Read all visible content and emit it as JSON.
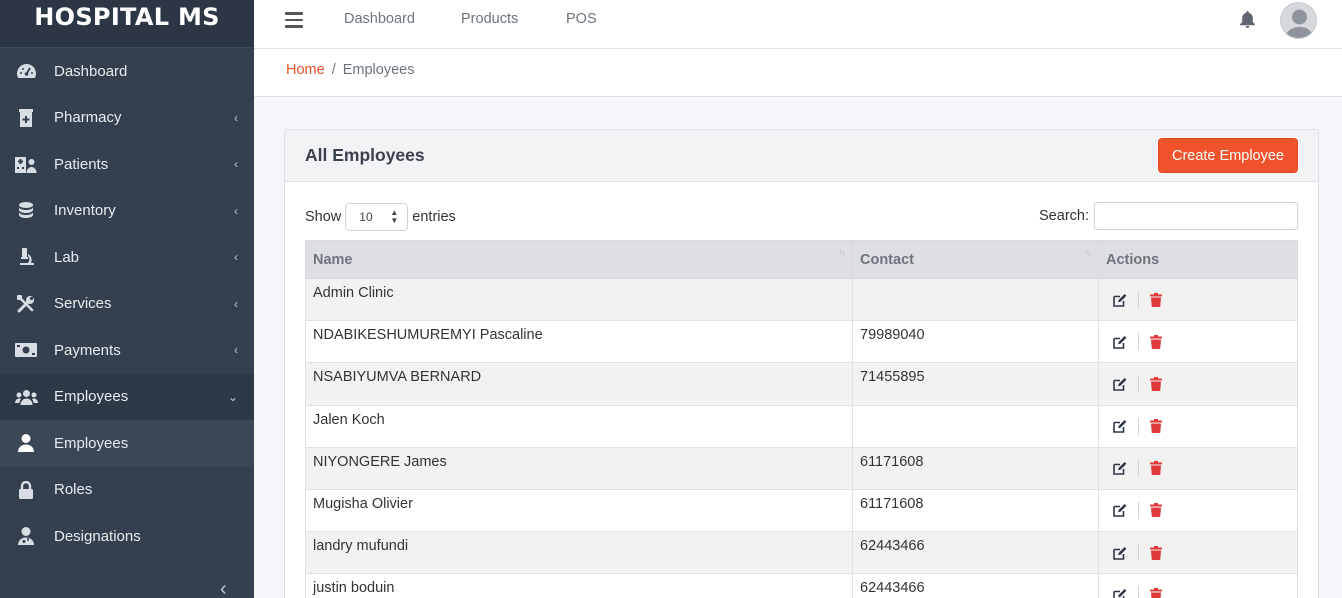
{
  "brand": "HOSPITAL MS",
  "sidebar": {
    "items": [
      {
        "label": "Dashboard",
        "icon": "tachometer-icon",
        "chevron": ""
      },
      {
        "label": "Pharmacy",
        "icon": "clinic-medical-icon",
        "chevron": "‹"
      },
      {
        "label": "Patients",
        "icon": "hospital-user-icon",
        "chevron": "‹"
      },
      {
        "label": "Inventory",
        "icon": "database-icon",
        "chevron": "‹"
      },
      {
        "label": "Lab",
        "icon": "microscope-icon",
        "chevron": "‹"
      },
      {
        "label": "Services",
        "icon": "tools-icon",
        "chevron": "‹"
      },
      {
        "label": "Payments",
        "icon": "money-bill-icon",
        "chevron": "‹"
      },
      {
        "label": "Employees",
        "icon": "users-icon",
        "chevron": "⌄"
      },
      {
        "label": "Employees",
        "icon": "user-icon",
        "chevron": ""
      },
      {
        "label": "Roles",
        "icon": "lock-icon",
        "chevron": ""
      },
      {
        "label": "Designations",
        "icon": "user-md-icon",
        "chevron": ""
      }
    ],
    "collapse": "‹"
  },
  "topnav": {
    "links": [
      "Dashboard",
      "Products",
      "POS"
    ]
  },
  "breadcrumb": {
    "home": "Home",
    "separator": "/",
    "current": "Employees"
  },
  "card": {
    "title": "All Employees",
    "create_label": "Create Employee"
  },
  "table_controls": {
    "show_label": "Show",
    "entries_value": "10",
    "entries_label": "entries",
    "search_label": "Search:",
    "search_value": ""
  },
  "table": {
    "columns": [
      "Name",
      "Contact",
      "Actions"
    ],
    "rows": [
      {
        "name": "Admin Clinic",
        "contact": ""
      },
      {
        "name": "NDABIKESHUMUREMYI Pascaline",
        "contact": "79989040"
      },
      {
        "name": "NSABIYUMVA BERNARD",
        "contact": "71455895"
      },
      {
        "name": "Jalen Koch",
        "contact": ""
      },
      {
        "name": "NIYONGERE James",
        "contact": "61171608"
      },
      {
        "name": "Mugisha Olivier",
        "contact": "61171608"
      },
      {
        "name": "landry mufundi",
        "contact": "62443466"
      },
      {
        "name": "justin boduin",
        "contact": "62443466"
      }
    ]
  },
  "colors": {
    "sidebar_bg": "#34404f",
    "accent": "#f0532b",
    "delete": "#e0393a",
    "edit": "#2c3645"
  }
}
